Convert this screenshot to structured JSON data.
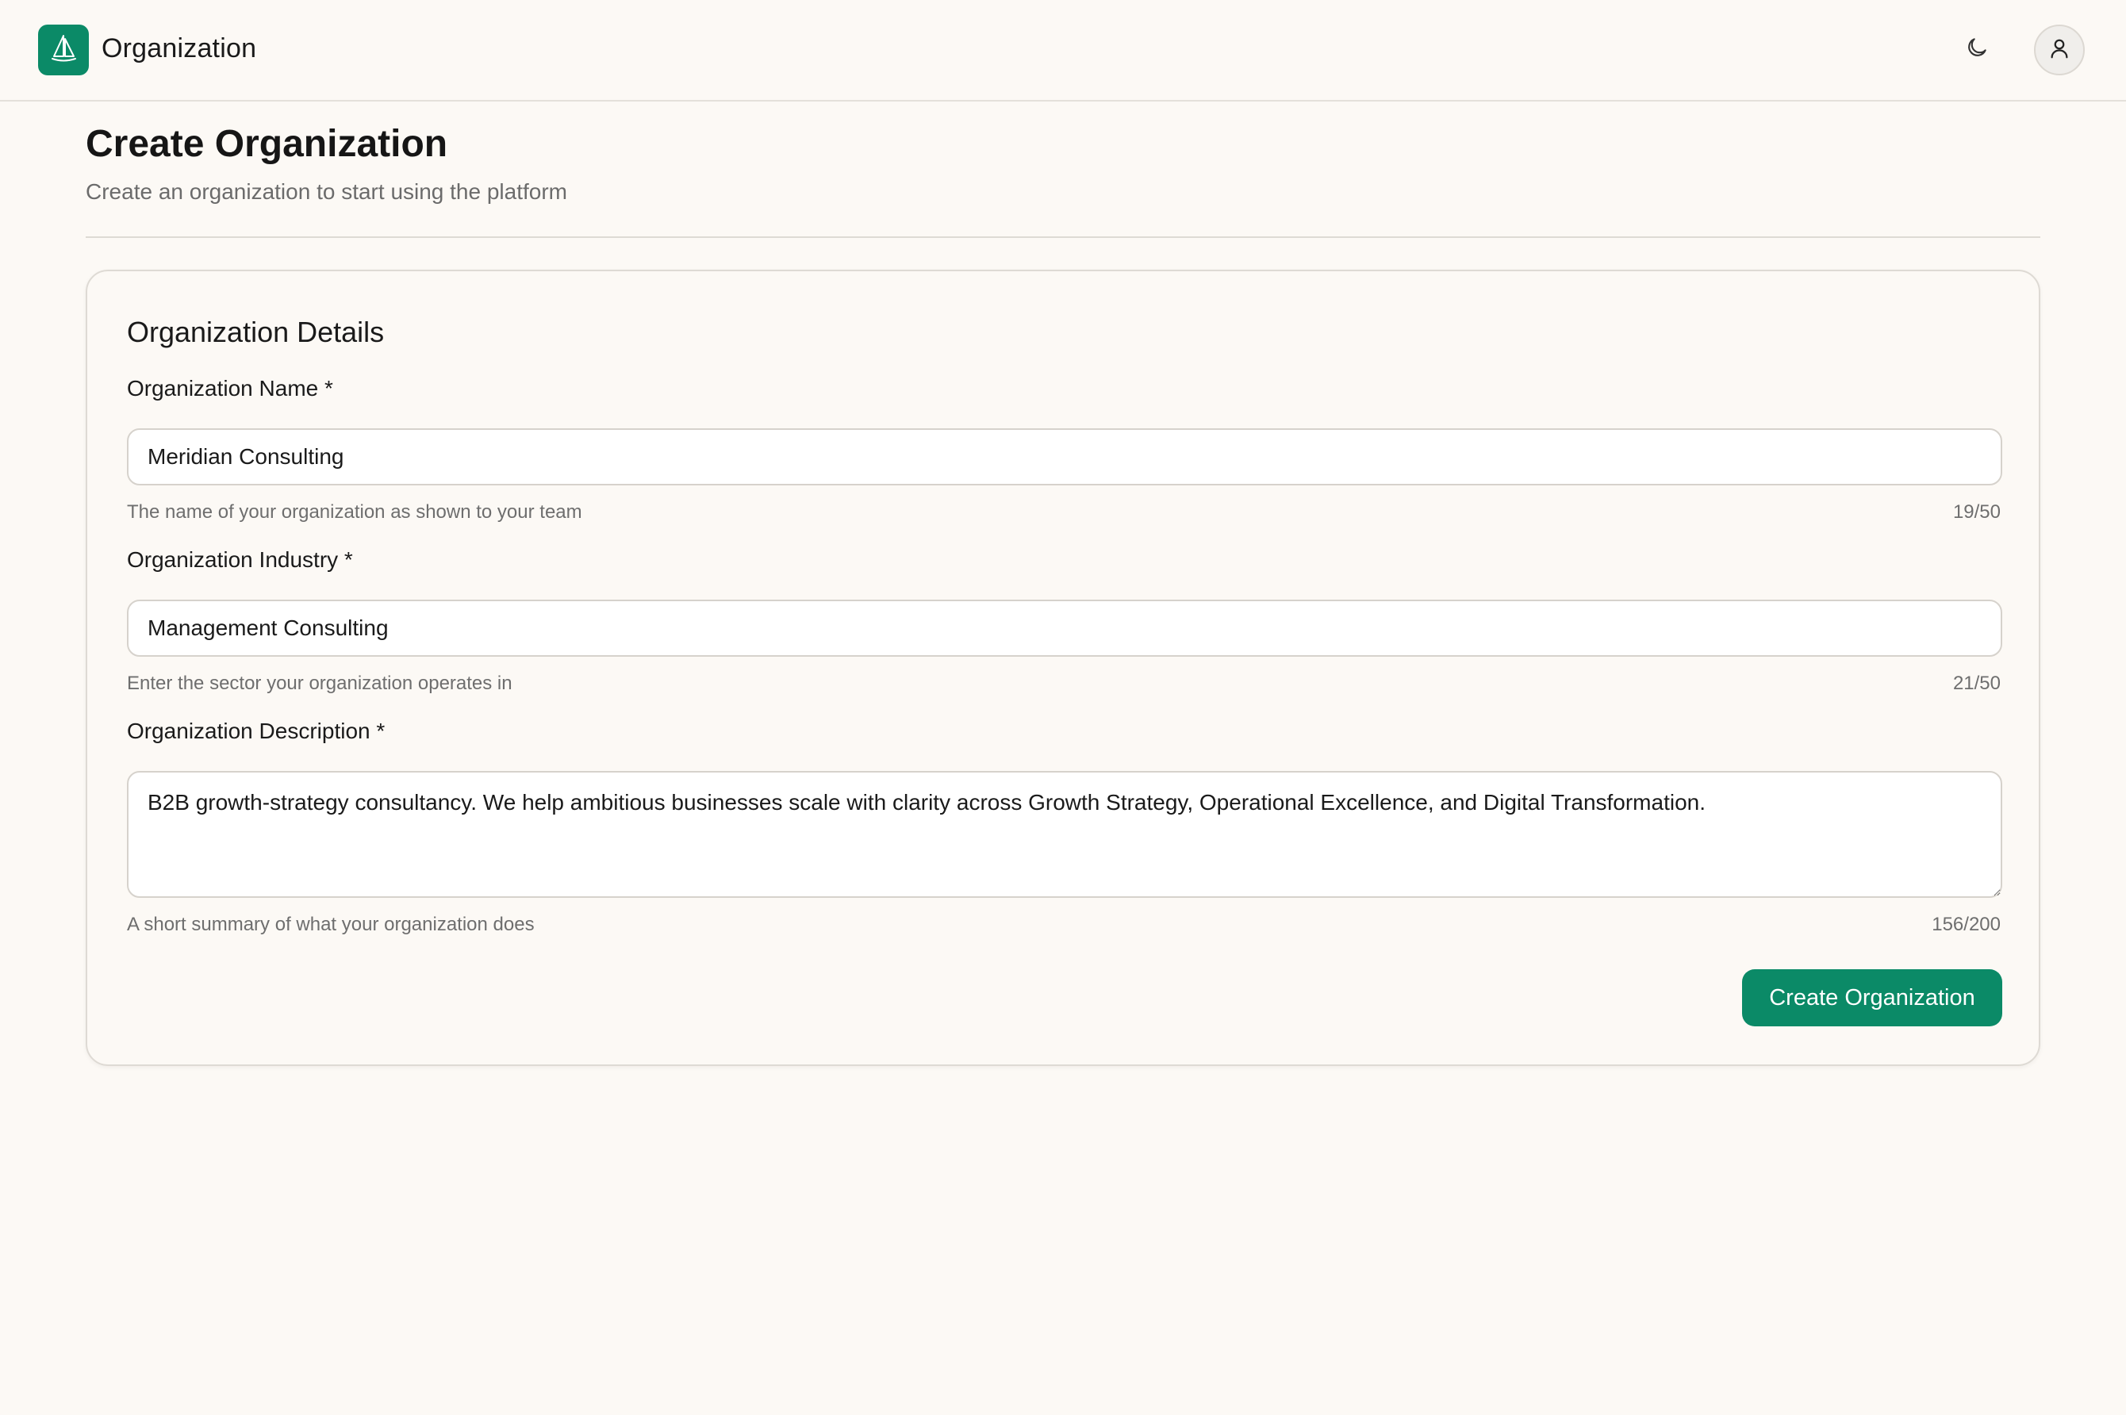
{
  "header": {
    "app_title": "Organization",
    "logo_icon": "sailboat-icon",
    "theme_icon": "moon-icon",
    "user_icon": "user-icon",
    "brand_color": "#0b8a67"
  },
  "page": {
    "title": "Create Organization",
    "subtitle": "Create an organization to start using the platform"
  },
  "card": {
    "title": "Organization Details",
    "fields": {
      "name": {
        "label": "Organization Name *",
        "value": "Meridian Consulting",
        "hint": "The name of your organization as shown to your team",
        "counter": "19/50"
      },
      "industry": {
        "label": "Organization Industry *",
        "value": "Management Consulting",
        "hint": "Enter the sector your organization operates in",
        "counter": "21/50"
      },
      "description": {
        "label": "Organization Description *",
        "value": "B2B growth-strategy consultancy. We help ambitious businesses scale with clarity across Growth Strategy, Operational Excellence, and Digital Transformation.",
        "hint": "A short summary of what your organization does",
        "counter": "156/200"
      }
    },
    "submit_label": "Create Organization"
  }
}
